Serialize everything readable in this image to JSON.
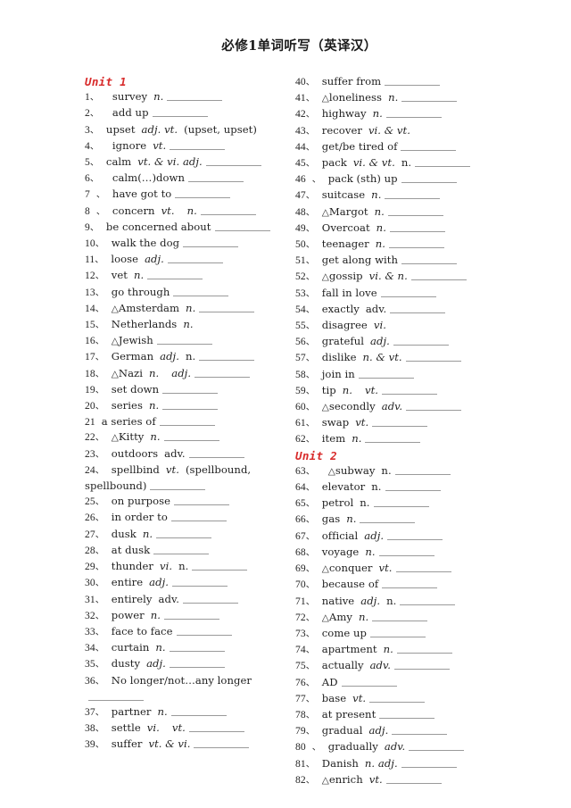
{
  "document": {
    "title": "必修1单词听写（英译汉）",
    "accent_color": "#d82b2b",
    "text_color": "#1f1f1f",
    "background": "#ffffff"
  },
  "columns": {
    "left": {
      "blocks": [
        {
          "type": "unit",
          "label": "Unit 1"
        },
        {
          "type": "entry",
          "num": "1",
          "sep": "、",
          "indent": true,
          "term": "survey",
          "pos": "n.",
          "blank": "m"
        },
        {
          "type": "entry",
          "num": "2",
          "sep": "、",
          "indent": true,
          "term": "add up",
          "pos": "",
          "blank": "m"
        },
        {
          "type": "entry",
          "num": "3",
          "sep": "、",
          "term": "upset",
          "pos": "adj. vt.",
          "tail": "(upset, upset)",
          "blank": "none"
        },
        {
          "type": "entry",
          "num": "4",
          "sep": "、",
          "indent": true,
          "term": "ignore",
          "pos": "vt.",
          "blank": "m"
        },
        {
          "type": "entry",
          "num": "5",
          "sep": "、",
          "term": "calm",
          "pos": "vt. & vi. adj.",
          "blank": "m"
        },
        {
          "type": "entry",
          "num": "6",
          "sep": "、",
          "indent": true,
          "term": "calm(…)down",
          "pos": "",
          "blank": "m"
        },
        {
          "type": "entry",
          "num": "7",
          "sep": "、",
          "spaced": true,
          "term": "have got to",
          "pos": "",
          "blank": "m"
        },
        {
          "type": "entry",
          "num": "8",
          "sep": "、",
          "spaced": true,
          "term": "concern",
          "pos": "vt.",
          "pos2": "n.",
          "blank": "m"
        },
        {
          "type": "entry",
          "num": "9",
          "sep": "、",
          "term": "be concerned about",
          "pos": "",
          "blank": "m"
        },
        {
          "type": "entry",
          "num": "10",
          "sep": "、",
          "term": "walk the dog",
          "pos": "",
          "blank": "m"
        },
        {
          "type": "entry",
          "num": "11",
          "sep": "、",
          "term": "loose",
          "pos": "adj.",
          "blank": "m"
        },
        {
          "type": "entry",
          "num": "12",
          "sep": "、",
          "term": "vet",
          "pos": "n.",
          "blank": "m"
        },
        {
          "type": "entry",
          "num": "13",
          "sep": "、",
          "term": "go through",
          "pos": "",
          "blank": "m"
        },
        {
          "type": "entry",
          "num": "14",
          "sep": "、",
          "tri": true,
          "term": "Amsterdam",
          "pos": "n.",
          "blank": "m"
        },
        {
          "type": "entry",
          "num": "15",
          "sep": "、",
          "term": "Netherlands",
          "pos": "n.",
          "blank": "none"
        },
        {
          "type": "entry",
          "num": "16",
          "sep": "、",
          "tri": true,
          "term": "Jewish",
          "pos": "",
          "blank": "m"
        },
        {
          "type": "entry",
          "num": "17",
          "sep": "、",
          "term": "German",
          "pos": "adj.",
          "pos_plain": "n.",
          "blank": "m"
        },
        {
          "type": "entry",
          "num": "18",
          "sep": "、",
          "tri": true,
          "term": "Nazi",
          "pos": "n.",
          "pos2": "adj.",
          "blank": "m"
        },
        {
          "type": "entry",
          "num": "19",
          "sep": "、",
          "term": "set down",
          "pos": "",
          "blank": "m"
        },
        {
          "type": "entry",
          "num": "20",
          "sep": "、",
          "term": "series",
          "pos": "n.",
          "blank": "m"
        },
        {
          "type": "entry",
          "num": "21",
          "sep": "",
          "spaced": true,
          "term": "a series of",
          "pos": "",
          "blank": "m"
        },
        {
          "type": "entry",
          "num": "22",
          "sep": "、",
          "tri": true,
          "term": "Kitty",
          "pos": "n.",
          "blank": "m"
        },
        {
          "type": "entry",
          "num": "23",
          "sep": "、",
          "term": "outdoors",
          "pos_plain": "adv.",
          "blank": "m"
        },
        {
          "type": "entry",
          "num": "24",
          "sep": "、",
          "term": "spellbind",
          "pos": "vt.",
          "tail": "(spellbound, spellbound)",
          "blank": "m",
          "wrap": true
        },
        {
          "type": "entry",
          "num": "25",
          "sep": "、",
          "term": "on purpose",
          "pos": "",
          "blank": "m"
        },
        {
          "type": "entry",
          "num": "26",
          "sep": "、",
          "term": "in order to",
          "pos": "",
          "blank": "m"
        },
        {
          "type": "entry",
          "num": "27",
          "sep": "、",
          "term": "dusk",
          "pos": "n.",
          "blank": "m"
        },
        {
          "type": "entry",
          "num": "28",
          "sep": "、",
          "term": "at dusk",
          "pos": "",
          "blank": "m"
        },
        {
          "type": "entry",
          "num": "29",
          "sep": "、",
          "term": "thunder",
          "pos": "vi.",
          "pos_plain": "n.",
          "blank": "m"
        },
        {
          "type": "entry",
          "num": "30",
          "sep": "、",
          "term": "entire",
          "pos": "adj.",
          "blank": "m"
        },
        {
          "type": "entry",
          "num": "31",
          "sep": "、",
          "term": "entirely",
          "pos_plain": "adv.",
          "blank": "m"
        },
        {
          "type": "entry",
          "num": "32",
          "sep": "、",
          "term": "power",
          "pos": "n.",
          "blank": "m"
        },
        {
          "type": "entry",
          "num": "33",
          "sep": "、",
          "term": "face to face",
          "pos": "",
          "blank": "m"
        },
        {
          "type": "entry",
          "num": "34",
          "sep": "、",
          "term": "curtain",
          "pos": "n.",
          "blank": "m"
        },
        {
          "type": "entry",
          "num": "35",
          "sep": "、",
          "term": "dusty",
          "pos": "adj.",
          "blank": "m"
        },
        {
          "type": "entry",
          "num": "36",
          "sep": "、",
          "term": "No longer/not…any longer",
          "pos": "",
          "blank": "m",
          "wrap": true
        },
        {
          "type": "entry",
          "num": "37",
          "sep": "、",
          "term": "partner",
          "pos": "n.",
          "blank": "m"
        },
        {
          "type": "entry",
          "num": "38",
          "sep": "、",
          "term": "settle",
          "pos": "vi.",
          "pos2": "vt.",
          "blank": "m"
        },
        {
          "type": "entry",
          "num": "39",
          "sep": "、",
          "term": "suffer",
          "pos": "vt. & vi.",
          "blank": "m"
        }
      ]
    },
    "right": {
      "blocks": [
        {
          "type": "entry",
          "num": "40",
          "sep": "、",
          "term": "suffer from",
          "pos": "",
          "blank": "m"
        },
        {
          "type": "entry",
          "num": "41",
          "sep": "、",
          "tri": true,
          "term": "loneliness",
          "pos": "n.",
          "blank": "m"
        },
        {
          "type": "entry",
          "num": "42",
          "sep": "、",
          "term": "highway",
          "pos": "n.",
          "blank": "m"
        },
        {
          "type": "entry",
          "num": "43",
          "sep": "、",
          "term": "recover",
          "pos": "vi. & vt.",
          "blank": "none"
        },
        {
          "type": "entry",
          "num": "44",
          "sep": "、",
          "term": "get/be tired of",
          "pos": "",
          "blank": "m"
        },
        {
          "type": "entry",
          "num": "45",
          "sep": "、",
          "term": "pack",
          "pos": "vi. & vt.",
          "pos_plain": "n.",
          "blank": "m"
        },
        {
          "type": "entry",
          "num": "46",
          "sep": "、",
          "spaced": true,
          "term": "pack (sth) up",
          "pos": "",
          "blank": "m"
        },
        {
          "type": "entry",
          "num": "47",
          "sep": "、",
          "term": "suitcase",
          "pos": "n.",
          "blank": "m"
        },
        {
          "type": "entry",
          "num": "48",
          "sep": "、",
          "tri": true,
          "term": "Margot",
          "pos": "n.",
          "blank": "m"
        },
        {
          "type": "entry",
          "num": "49",
          "sep": "、",
          "term": "Overcoat",
          "pos": "n.",
          "blank": "m"
        },
        {
          "type": "entry",
          "num": "50",
          "sep": "、",
          "term": "teenager",
          "pos": "n.",
          "blank": "m"
        },
        {
          "type": "entry",
          "num": "51",
          "sep": "、",
          "term": "get along with",
          "pos": "",
          "blank": "m"
        },
        {
          "type": "entry",
          "num": "52",
          "sep": "、",
          "tri": true,
          "term": "gossip",
          "pos": "vi. & n.",
          "blank": "m"
        },
        {
          "type": "entry",
          "num": "53",
          "sep": "、",
          "term": "fall in love",
          "pos": "",
          "blank": "m"
        },
        {
          "type": "entry",
          "num": "54",
          "sep": "、",
          "term": "exactly",
          "pos_plain": "adv.",
          "blank": "m"
        },
        {
          "type": "entry",
          "num": "55",
          "sep": "、",
          "term": "disagree",
          "pos": "vi.",
          "blank": "none"
        },
        {
          "type": "entry",
          "num": "56",
          "sep": "、",
          "term": "grateful",
          "pos": "adj.",
          "blank": "m"
        },
        {
          "type": "entry",
          "num": "57",
          "sep": "、",
          "term": "dislike",
          "pos": "n. & vt.",
          "blank": "m"
        },
        {
          "type": "entry",
          "num": "58",
          "sep": "、",
          "term": "join in",
          "pos": "",
          "blank": "m"
        },
        {
          "type": "entry",
          "num": "59",
          "sep": "、",
          "term": "tip",
          "pos": "n.",
          "pos2": "vt.",
          "blank": "m"
        },
        {
          "type": "entry",
          "num": "60",
          "sep": "、",
          "tri": true,
          "term": "secondly",
          "pos": "adv.",
          "blank": "m"
        },
        {
          "type": "entry",
          "num": "61",
          "sep": "、",
          "term": "swap",
          "pos": "vt.",
          "blank": "m"
        },
        {
          "type": "entry",
          "num": "62",
          "sep": "、",
          "term": "item",
          "pos": "n.",
          "blank": "m"
        },
        {
          "type": "unit",
          "label": "Unit 2"
        },
        {
          "type": "entry",
          "num": "63",
          "sep": "、",
          "indent": true,
          "tri": true,
          "term": "subway",
          "pos_plain": "n.",
          "blank": "m"
        },
        {
          "type": "entry",
          "num": "64",
          "sep": "、",
          "term": "elevator",
          "pos_plain": "n.",
          "blank": "m"
        },
        {
          "type": "entry",
          "num": "65",
          "sep": "、",
          "term": "petrol",
          "pos_plain": "n.",
          "blank": "m"
        },
        {
          "type": "entry",
          "num": "66",
          "sep": "、",
          "term": "gas",
          "pos": "n.",
          "blank": "m"
        },
        {
          "type": "entry",
          "num": "67",
          "sep": "、",
          "term": "official",
          "pos": "adj.",
          "blank": "m"
        },
        {
          "type": "entry",
          "num": "68",
          "sep": "、",
          "term": "voyage",
          "pos": "n.",
          "blank": "m"
        },
        {
          "type": "entry",
          "num": "69",
          "sep": "、",
          "tri": true,
          "term": "conquer",
          "pos": "vt.",
          "blank": "m"
        },
        {
          "type": "entry",
          "num": "70",
          "sep": "、",
          "term": "because of",
          "pos": "",
          "blank": "m"
        },
        {
          "type": "entry",
          "num": "71",
          "sep": "、",
          "term": "native",
          "pos": "adj.",
          "pos_plain": "n.",
          "blank": "m"
        },
        {
          "type": "entry",
          "num": "72",
          "sep": "、",
          "tri": true,
          "term": "Amy",
          "pos": "n.",
          "blank": "m"
        },
        {
          "type": "entry",
          "num": "73",
          "sep": "、",
          "term": "come up",
          "pos": "",
          "blank": "m"
        },
        {
          "type": "entry",
          "num": "74",
          "sep": "、",
          "term": "apartment",
          "pos": "n.",
          "blank": "m"
        },
        {
          "type": "entry",
          "num": "75",
          "sep": "、",
          "term": "actually",
          "pos": "adv.",
          "blank": "m"
        },
        {
          "type": "entry",
          "num": "76",
          "sep": "、",
          "term": "AD",
          "pos": "",
          "blank": "m"
        },
        {
          "type": "entry",
          "num": "77",
          "sep": "、",
          "term": "base",
          "pos": "vt.",
          "blank": "m"
        },
        {
          "type": "entry",
          "num": "78",
          "sep": "、",
          "term": "at present",
          "pos": "",
          "blank": "m"
        },
        {
          "type": "entry",
          "num": "79",
          "sep": "、",
          "term": "gradual",
          "pos": "adj.",
          "blank": "m"
        },
        {
          "type": "entry",
          "num": "80",
          "sep": "、",
          "spaced": true,
          "term": "gradually",
          "pos": "adv.",
          "blank": "m"
        },
        {
          "type": "entry",
          "num": "81",
          "sep": "、",
          "term": "Danish",
          "pos": "n. adj.",
          "blank": "m"
        },
        {
          "type": "entry",
          "num": "82",
          "sep": "、",
          "tri": true,
          "term": "enrich",
          "pos": "vt.",
          "blank": "m"
        }
      ]
    }
  }
}
